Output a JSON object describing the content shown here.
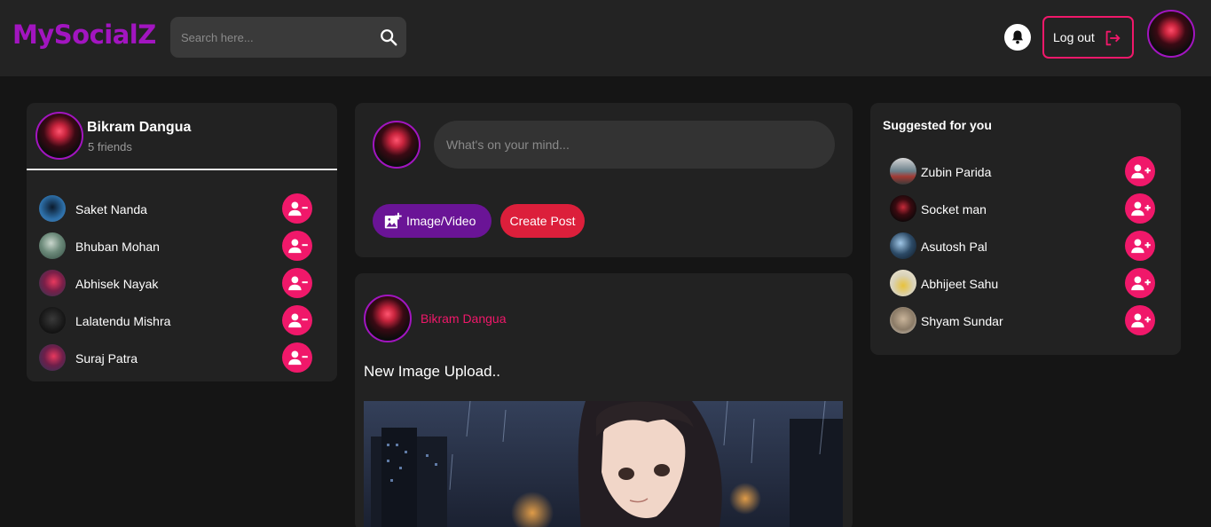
{
  "header": {
    "logo": "MySocialZ",
    "search_placeholder": "Search here...",
    "logout_label": "Log out"
  },
  "profile": {
    "name": "Bikram Dangua",
    "friends_count": "5 friends"
  },
  "friends": [
    {
      "name": "Saket Nanda"
    },
    {
      "name": "Bhuban Mohan"
    },
    {
      "name": "Abhisek Nayak"
    },
    {
      "name": "Lalatendu Mishra"
    },
    {
      "name": "Suraj Patra"
    }
  ],
  "composer": {
    "placeholder": "What's on your mind...",
    "image_video_label": "Image/Video",
    "create_post_label": "Create Post"
  },
  "post": {
    "author": "Bikram Dangua",
    "text": "New Image Upload.."
  },
  "suggested": {
    "title": "Suggested for you",
    "users": [
      {
        "name": "Zubin Parida"
      },
      {
        "name": "Socket man"
      },
      {
        "name": "Asutosh Pal"
      },
      {
        "name": "Abhijeet Sahu"
      },
      {
        "name": "Shyam Sundar"
      }
    ]
  },
  "colors": {
    "accent_pink": "#f0186a",
    "brand_purple": "#a215c0",
    "button_purple": "#6a1496",
    "button_red": "#dc1f3b"
  },
  "icons": [
    "search-icon",
    "bell-icon",
    "logout-icon",
    "remove-friend-icon",
    "add-friend-icon",
    "add-photo-icon"
  ]
}
